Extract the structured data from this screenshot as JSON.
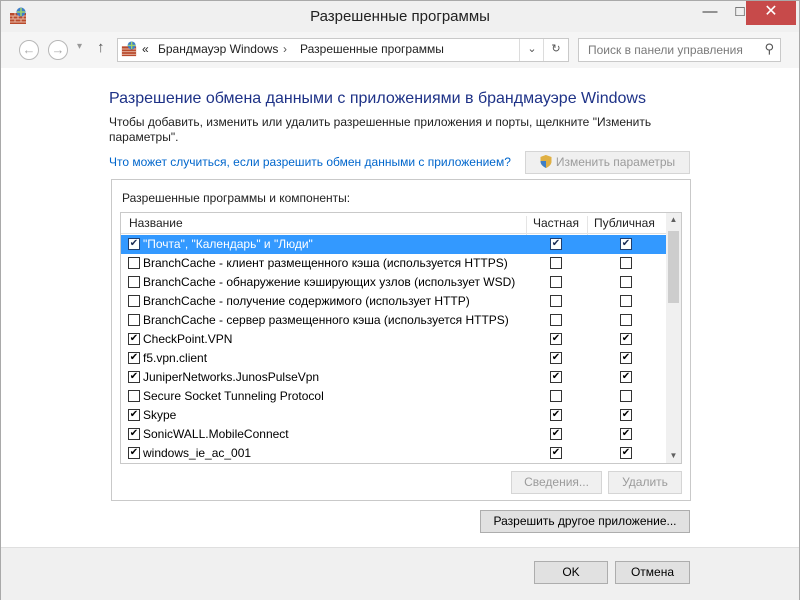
{
  "window": {
    "title": "Разрешенные программы",
    "minimize": "—",
    "maximize": "□",
    "close": "✕"
  },
  "nav": {
    "back": "←",
    "forward": "→",
    "recent": "▾",
    "up": "↑",
    "breadcrumb_prefix": "«",
    "breadcrumb": [
      "Брандмауэр Windows",
      "Разрешенные программы"
    ],
    "separator": "›",
    "dropdown": "⌄",
    "refresh": "↻",
    "search_placeholder": "Поиск в панели управления",
    "search_icon": "⚲"
  },
  "main": {
    "heading": "Разрешение обмена данными с приложениями в брандмауэре Windows",
    "description": "Чтобы добавить, изменить или удалить разрешенные приложения и порты, щелкните \"Изменить параметры\".",
    "risk_link": "Что может случиться, если разрешить обмен данными с приложением?",
    "change_settings": "Изменить параметры"
  },
  "list": {
    "group_label": "Разрешенные программы и компоненты:",
    "columns": {
      "name": "Название",
      "private": "Частная",
      "public": "Публичная"
    },
    "rows": [
      {
        "name": "\"Почта\", \"Календарь\" и \"Люди\"",
        "enabled": true,
        "private": true,
        "public": true,
        "selected": true
      },
      {
        "name": "BranchCache - клиент размещенного кэша (используется HTTPS)",
        "enabled": false,
        "private": false,
        "public": false
      },
      {
        "name": "BranchCache - обнаружение кэширующих узлов (использует WSD)",
        "enabled": false,
        "private": false,
        "public": false
      },
      {
        "name": "BranchCache - получение содержимого (использует HTTP)",
        "enabled": false,
        "private": false,
        "public": false
      },
      {
        "name": "BranchCache - сервер размещенного кэша (используется HTTPS)",
        "enabled": false,
        "private": false,
        "public": false
      },
      {
        "name": "CheckPoint.VPN",
        "enabled": true,
        "private": true,
        "public": true
      },
      {
        "name": "f5.vpn.client",
        "enabled": true,
        "private": true,
        "public": true
      },
      {
        "name": "JuniperNetworks.JunosPulseVpn",
        "enabled": true,
        "private": true,
        "public": true
      },
      {
        "name": "Secure Socket Tunneling Protocol",
        "enabled": false,
        "private": false,
        "public": false
      },
      {
        "name": "Skype",
        "enabled": true,
        "private": true,
        "public": true
      },
      {
        "name": "SonicWALL.MobileConnect",
        "enabled": true,
        "private": true,
        "public": true
      },
      {
        "name": "windows_ie_ac_001",
        "enabled": true,
        "private": true,
        "public": true
      }
    ],
    "details_button": "Сведения...",
    "remove_button": "Удалить"
  },
  "allow_other_button": "Разрешить другое приложение...",
  "footer": {
    "ok": "OK",
    "cancel": "Отмена"
  }
}
